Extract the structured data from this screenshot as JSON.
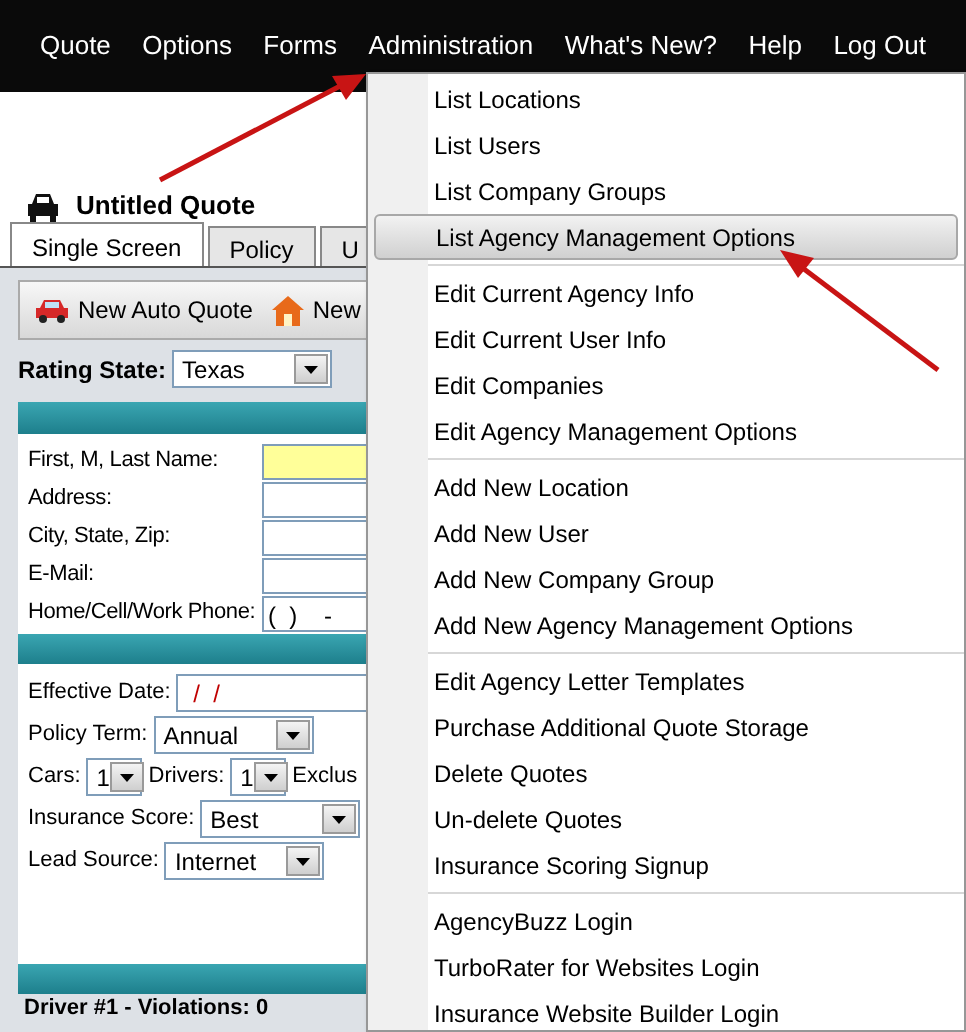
{
  "nav": {
    "items": [
      "Quote",
      "Options",
      "Forms",
      "Administration",
      "What's New?",
      "Help",
      "Log Out"
    ]
  },
  "quote": {
    "title": "Untitled Quote",
    "tabs": [
      {
        "label": "Single Screen",
        "selected": true
      },
      {
        "label": "Policy",
        "selected": false
      },
      {
        "label": "U",
        "selected": false
      }
    ],
    "toolbar": [
      {
        "label": "New Auto Quote",
        "kind": "car"
      },
      {
        "label": "New",
        "kind": "home"
      }
    ],
    "rating_state": {
      "label": "Rating State:",
      "value": "Texas"
    },
    "applicant": [
      {
        "label": "First, M, Last Name:",
        "required": true
      },
      {
        "label": "Address:",
        "required": false
      },
      {
        "label": "City, State, Zip:",
        "required": false
      },
      {
        "label": "E-Mail:",
        "required": false
      },
      {
        "label": "Home/Cell/Work Phone:",
        "value": "(  )    -",
        "required": false
      }
    ],
    "policy": [
      [
        {
          "kind": "text",
          "label": "Effective Date:",
          "value": " /  /"
        }
      ],
      [
        {
          "kind": "select",
          "label": "Policy Term:",
          "value": "Annual"
        }
      ],
      [
        {
          "kind": "small_select",
          "label": "Cars:",
          "value": "1"
        },
        {
          "kind": "small_select",
          "label": "Drivers:",
          "value": "1"
        },
        {
          "kind": "label",
          "label": "Exclus"
        }
      ],
      [
        {
          "kind": "select",
          "label": "Insurance Score:",
          "value": "Best"
        }
      ],
      [
        {
          "kind": "select",
          "label": "Lead Source:",
          "value": "Internet"
        }
      ]
    ],
    "driver_section": "Driver #1 - Violations: 0"
  },
  "menu": {
    "groups": [
      [
        {
          "label": "List Locations",
          "selected": false
        },
        {
          "label": "List Users",
          "selected": false
        },
        {
          "label": "List Company Groups",
          "selected": false
        },
        {
          "label": "List Agency Management Options",
          "selected": true
        }
      ],
      [
        {
          "label": "Edit Current Agency Info",
          "selected": false
        },
        {
          "label": "Edit Current User Info",
          "selected": false
        },
        {
          "label": "Edit Companies",
          "selected": false
        },
        {
          "label": "Edit Agency Management Options",
          "selected": false
        }
      ],
      [
        {
          "label": "Add New Location",
          "selected": false
        },
        {
          "label": "Add New User",
          "selected": false
        },
        {
          "label": "Add New Company Group",
          "selected": false
        },
        {
          "label": "Add New Agency Management Options",
          "selected": false
        }
      ],
      [
        {
          "label": "Edit Agency Letter Templates",
          "selected": false
        },
        {
          "label": "Purchase Additional Quote Storage",
          "selected": false
        },
        {
          "label": "Delete Quotes",
          "selected": false
        },
        {
          "label": "Un-delete Quotes",
          "selected": false
        },
        {
          "label": "Insurance Scoring Signup",
          "selected": false
        }
      ],
      [
        {
          "label": "AgencyBuzz Login",
          "selected": false
        },
        {
          "label": "TurboRater for Websites Login",
          "selected": false
        },
        {
          "label": "Insurance Website Builder Login",
          "selected": false
        }
      ]
    ]
  }
}
